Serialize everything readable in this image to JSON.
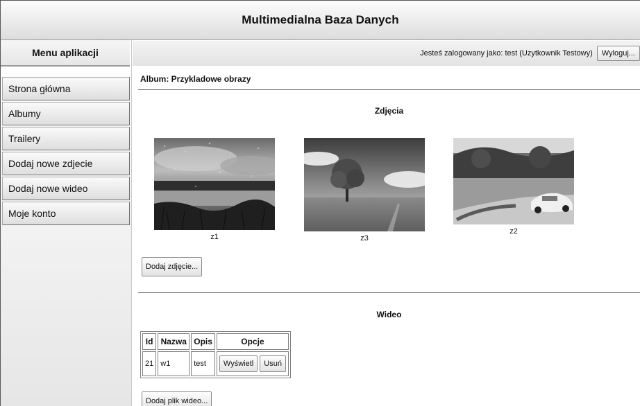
{
  "header": {
    "title": "Multimedialna Baza Danych"
  },
  "sidebar": {
    "title": "Menu aplikacji",
    "items": [
      {
        "label": "Strona główna"
      },
      {
        "label": "Albumy"
      },
      {
        "label": "Trailery"
      },
      {
        "label": "Dodaj nowe zdjecie"
      },
      {
        "label": "Dodaj nowe wideo"
      },
      {
        "label": "Moje konto"
      }
    ]
  },
  "userbar": {
    "text": "Jesteś zalogowany jako: test (Uzytkownik Testowy)",
    "logout_label": "Wyloguj..."
  },
  "album": {
    "title": "Album: Przykladowe obrazy"
  },
  "photos": {
    "section_title": "Zdjęcia",
    "items": [
      {
        "caption": "z1",
        "icon": "rainy-lake-photo"
      },
      {
        "caption": "z3",
        "icon": "tree-field-photo"
      },
      {
        "caption": "z2",
        "icon": "car-road-photo"
      }
    ],
    "add_label": "Dodaj zdjęcie..."
  },
  "videos": {
    "section_title": "Wideo",
    "headers": [
      "Id",
      "Nazwa",
      "Opis",
      "Opcje"
    ],
    "rows": [
      {
        "id": "21",
        "name": "w1",
        "desc": "test",
        "view_label": "Wyświetl",
        "delete_label": "Usuń"
      }
    ],
    "add_label": "Dodaj plik wideo..."
  }
}
